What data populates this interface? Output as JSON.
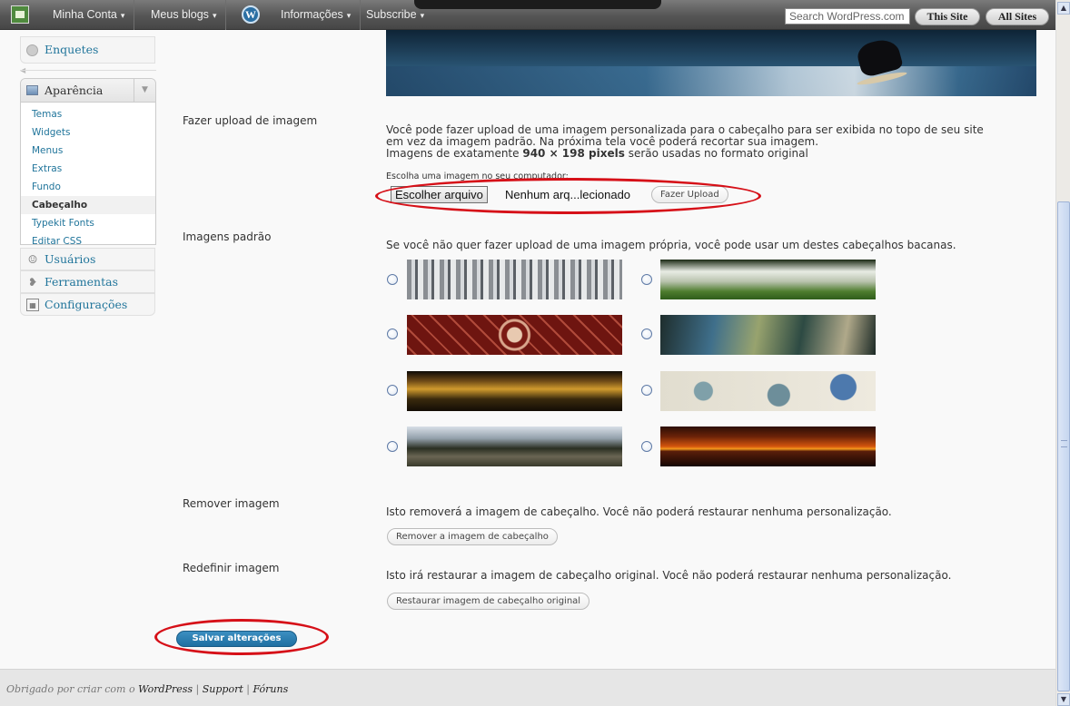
{
  "adminbar": {
    "minha_conta": "Minha Conta",
    "meus_blogs": "Meus blogs",
    "informacoes": "Informações",
    "subscribe": "Subscribe",
    "caret": "▾",
    "wp_logo": "W",
    "search_placeholder": "Search WordPress.com",
    "this_site": "This Site",
    "all_sites": "All Sites"
  },
  "sidebar": {
    "enquetes": "Enquetes",
    "collapse_arrow": "◀",
    "aparencia": "Aparência",
    "aparencia_toggle": "▼",
    "submenu": [
      "Temas",
      "Widgets",
      "Menus",
      "Extras",
      "Fundo",
      "Cabeçalho",
      "Typekit Fonts",
      "Editar CSS"
    ],
    "current_submenu": "Cabeçalho",
    "usuarios": "Usuários",
    "ferramentas": "Ferramentas",
    "configuracoes": "Configurações",
    "icons": {
      "enquetes": "poll-icon",
      "usuarios": "users-icon",
      "ferramentas": "tools-icon",
      "configuracoes": "settings-icon"
    }
  },
  "upload": {
    "label": "Fazer upload de imagem",
    "desc_line1": "Você pode fazer upload de uma imagem personalizada para o cabeçalho para ser exibida no topo de seu site",
    "desc_line2": "em vez da imagem padrão. Na próxima tela você poderá recortar sua imagem.",
    "desc_line3_pre": "Imagens de exatamente ",
    "desc_line3_bold": "940 × 198 pixels",
    "desc_line3_post": " serão usadas no formato original",
    "choose_label": "Escolha uma imagem no seu computador:",
    "file_button": "Escolher arquivo",
    "file_name": "Nenhum arq...lecionado",
    "upload_button": "Fazer Upload"
  },
  "default_images": {
    "label": "Imagens padrão",
    "desc": "Se você não quer fazer upload de uma imagem própria, você pode usar um destes cabeçalhos bacanas."
  },
  "remove": {
    "label": "Remover imagem",
    "desc": "Isto removerá a imagem de cabeçalho. Você não poderá restaurar nenhuma personalização.",
    "button": "Remover a imagem de cabeçalho"
  },
  "reset": {
    "label": "Redefinir imagem",
    "desc": "Isto irá restaurar a imagem de cabeçalho original. Você não poderá restaurar nenhuma personalização.",
    "button": "Restaurar imagem de cabeçalho original"
  },
  "save_button": "Salvar alterações",
  "footer": {
    "pre": "Obrigado por criar com o ",
    "wordpress": "WordPress",
    "sep1": " | ",
    "support": "Support",
    "sep2": " | ",
    "forums": "Fóruns"
  },
  "colors": {
    "link": "#21759b",
    "annotation": "#d61018",
    "primary_button": "#21759b"
  }
}
